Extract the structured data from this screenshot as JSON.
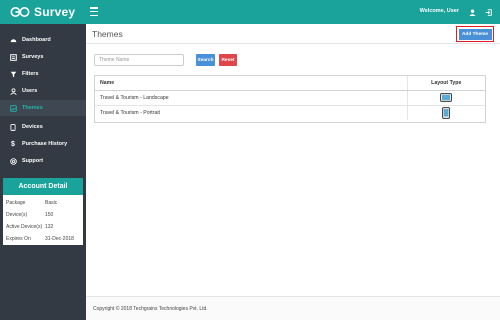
{
  "brand": {
    "name": "Survey"
  },
  "header": {
    "welcome": "Welcome, User"
  },
  "sidebar": {
    "items": [
      {
        "label": "Dashboard",
        "icon": "dashboard-icon",
        "active": false
      },
      {
        "label": "Surveys",
        "icon": "surveys-icon",
        "active": false
      },
      {
        "label": "Filters",
        "icon": "filter-icon",
        "active": false
      },
      {
        "label": "Users",
        "icon": "users-icon",
        "active": false
      },
      {
        "label": "Themes",
        "icon": "themes-icon",
        "active": true
      },
      {
        "label": "Devices",
        "icon": "devices-icon",
        "active": false
      },
      {
        "label": "Purchase History",
        "icon": "dollar-icon",
        "active": false
      },
      {
        "label": "Support",
        "icon": "support-icon",
        "active": false
      }
    ]
  },
  "account": {
    "title": "Account Detail",
    "rows": [
      {
        "key": "Package",
        "value": "Basic"
      },
      {
        "key": "Device(s)",
        "value": "150"
      },
      {
        "key": "Active Device(s)",
        "value": "132"
      },
      {
        "key": "Expires On",
        "value": "31-Dec-2018"
      }
    ]
  },
  "main": {
    "title": "Themes",
    "add_button": "Add Theme",
    "search": {
      "placeholder": "Theme Name",
      "value": ""
    },
    "search_button": "Search",
    "reset_button": "Reset",
    "table": {
      "columns": [
        "Name",
        "Layout Type"
      ],
      "rows": [
        {
          "name": "Travel & Tourism - Landscape",
          "layout": "landscape-icon"
        },
        {
          "name": "Travel & Tourism - Portrait",
          "layout": "portrait-icon"
        }
      ]
    }
  },
  "footer": {
    "text": "Copyright © 2018 Techgrains Technologies Pvt. Ltd."
  },
  "colors": {
    "primary": "#1aa39a",
    "sidebar": "#333a44",
    "button_blue": "#4a90d9",
    "button_red": "#e0454a",
    "highlight": "#e01d24"
  }
}
